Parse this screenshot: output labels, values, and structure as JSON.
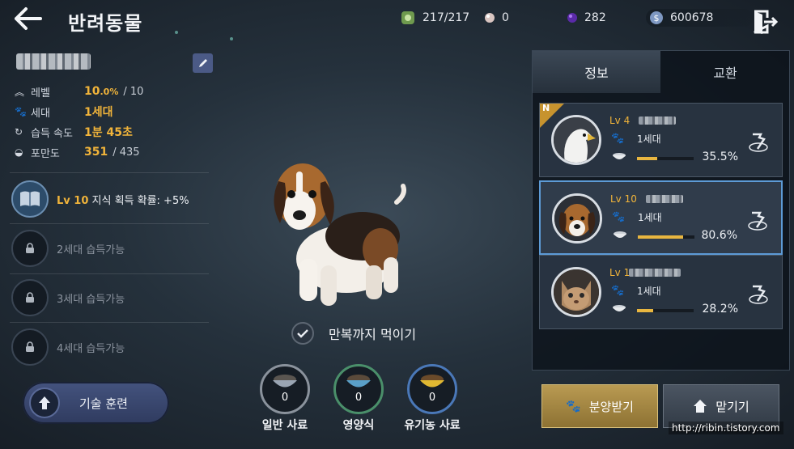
{
  "header": {
    "title": "반려동물",
    "currencies": [
      {
        "icon": "energy-icon",
        "value": "217/217",
        "color": "#8fb86a"
      },
      {
        "icon": "pearl-icon",
        "value": "0",
        "color": "#d9c5c1"
      },
      {
        "icon": "purple-gem-icon",
        "value": "282",
        "color": "#7b3fd0"
      },
      {
        "icon": "silver-coin-icon",
        "value": "600678",
        "color": "#9fb4d6"
      }
    ]
  },
  "pet": {
    "stats": [
      {
        "icon": "level-chevron-icon",
        "label": "레벨",
        "value": "10",
        "value_small": ".0%",
        "max": "/ 10"
      },
      {
        "icon": "paw-icon",
        "label": "세대",
        "value": "1세대",
        "value_small": "",
        "max": ""
      },
      {
        "icon": "refresh-icon",
        "label": "습득 속도",
        "value": "1분 45초",
        "value_small": "",
        "max": ""
      },
      {
        "icon": "bowl-icon",
        "label": "포만도",
        "value": "351",
        "value_small": "",
        "max": "/ 435"
      }
    ],
    "skills": [
      {
        "lv": "Lv 10",
        "text": "지식 획득 확률: +5%",
        "locked": false
      },
      {
        "lv": "",
        "text": "2세대 습득가능",
        "locked": true
      },
      {
        "lv": "",
        "text": "3세대 습득가능",
        "locked": true
      },
      {
        "lv": "",
        "text": "4세대 습득가능",
        "locked": true
      }
    ],
    "train_label": "기술 훈련"
  },
  "center": {
    "full_feed_label": "만복까지 먹이기",
    "feeds": [
      {
        "label": "일반 사료",
        "count": "0",
        "ring": "#8a929c",
        "bowl": "#9aa5b3"
      },
      {
        "label": "영양식",
        "count": "0",
        "ring": "#4a8f6a",
        "bowl": "#5aa0c8"
      },
      {
        "label": "유기농 사료",
        "count": "0",
        "ring": "#4a78b8",
        "bowl": "#e0b832"
      }
    ]
  },
  "right": {
    "tabs": [
      "정보",
      "교환"
    ],
    "cards": [
      {
        "lv": "Lv 4",
        "gen": "1세대",
        "pct": "35.5%",
        "fill": 0.355,
        "grade": "N",
        "animal": "eagle"
      },
      {
        "lv": "Lv 10",
        "gen": "1세대",
        "pct": "80.6%",
        "fill": 0.806,
        "grade": "",
        "animal": "beagle"
      },
      {
        "lv": "Lv 1",
        "gen": "1세대",
        "pct": "28.2%",
        "fill": 0.282,
        "grade": "",
        "animal": "cat"
      }
    ],
    "adopt_label": "분양받기",
    "deposit_label": "맡기기"
  },
  "watermark": "http://ribin.tistory.com"
}
